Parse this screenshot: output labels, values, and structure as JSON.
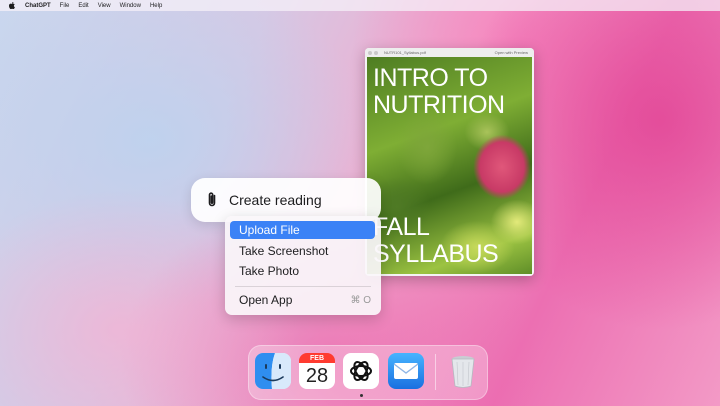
{
  "menubar": {
    "apple_icon": "apple-icon",
    "app_name": "ChatGPT",
    "items": [
      "File",
      "Edit",
      "View",
      "Window",
      "Help"
    ]
  },
  "preview": {
    "filename": "NUTR101_Syllabus.pdf",
    "open_with": "Open with Preview",
    "cover_title_line1": "INTRO TO",
    "cover_title_line2": "NUTRITION",
    "cover_subtitle_line1": "FALL",
    "cover_subtitle_line2": "SYLLABUS"
  },
  "pill": {
    "icon": "paperclip-icon",
    "label": "Create reading"
  },
  "menu": {
    "items": [
      {
        "label": "Upload File",
        "selected": true
      },
      {
        "label": "Take Screenshot",
        "selected": false
      },
      {
        "label": "Take Photo",
        "selected": false
      },
      {
        "label": "Open App",
        "shortcut": "⌘ O",
        "selected": false
      }
    ]
  },
  "dock": {
    "apps": [
      "finder-icon",
      "calendar-icon",
      "chatgpt-icon",
      "mail-icon",
      "trash-icon"
    ],
    "calendar_month": "FEB",
    "calendar_day": "28"
  },
  "colors": {
    "selection": "#3b82f6",
    "calendar_red": "#ff3b30"
  }
}
